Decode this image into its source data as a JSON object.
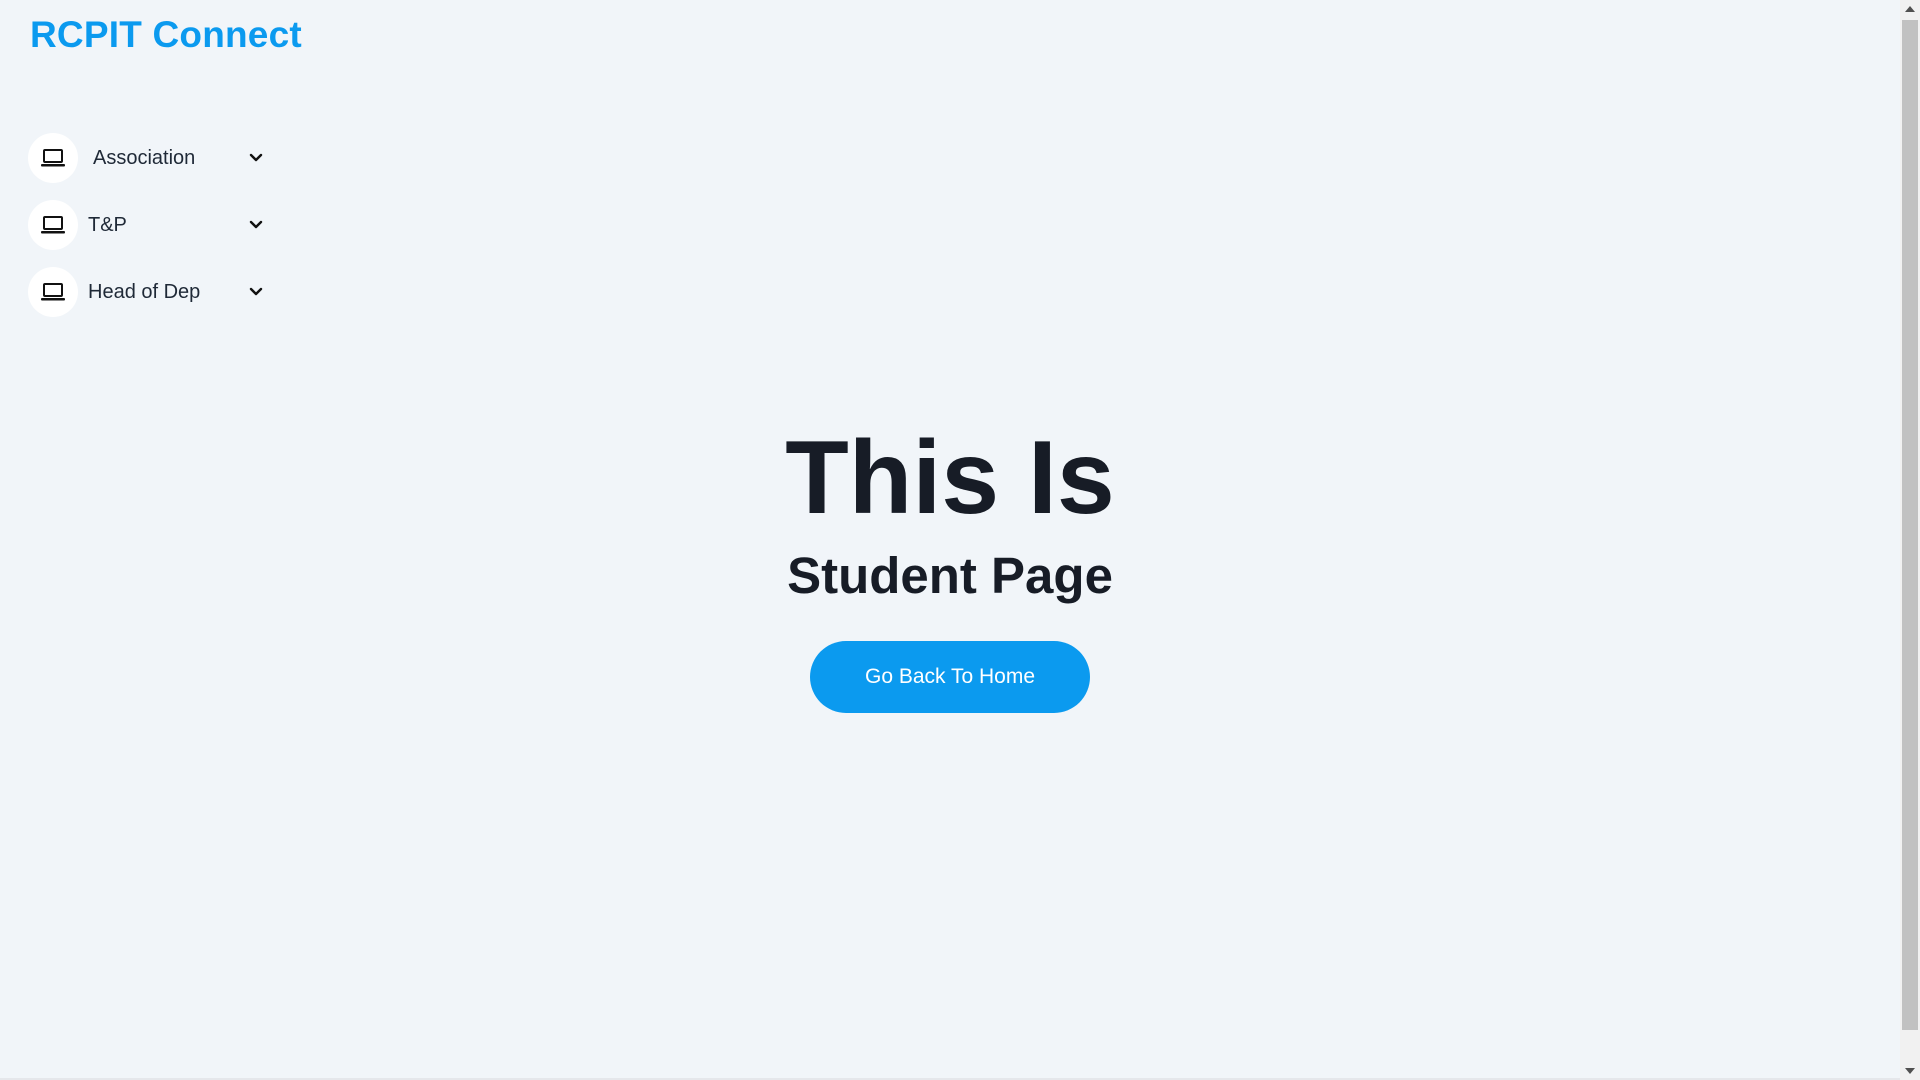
{
  "app": {
    "brand": "RCPIT Connect"
  },
  "sidebar": {
    "items": [
      {
        "label": "Association",
        "icon": "laptop-icon",
        "chevron": "chevron-down-icon"
      },
      {
        "label": "T&P",
        "icon": "laptop-icon",
        "chevron": "chevron-down-icon"
      },
      {
        "label": "Head of Dep",
        "icon": "laptop-icon",
        "chevron": "chevron-down-icon"
      }
    ]
  },
  "hero": {
    "title": "This Is",
    "subtitle": "Student Page",
    "button_label": "Go Back To Home"
  },
  "colors": {
    "accent": "#0b9aef",
    "background": "#f1f5f9",
    "heading": "#171c26"
  }
}
